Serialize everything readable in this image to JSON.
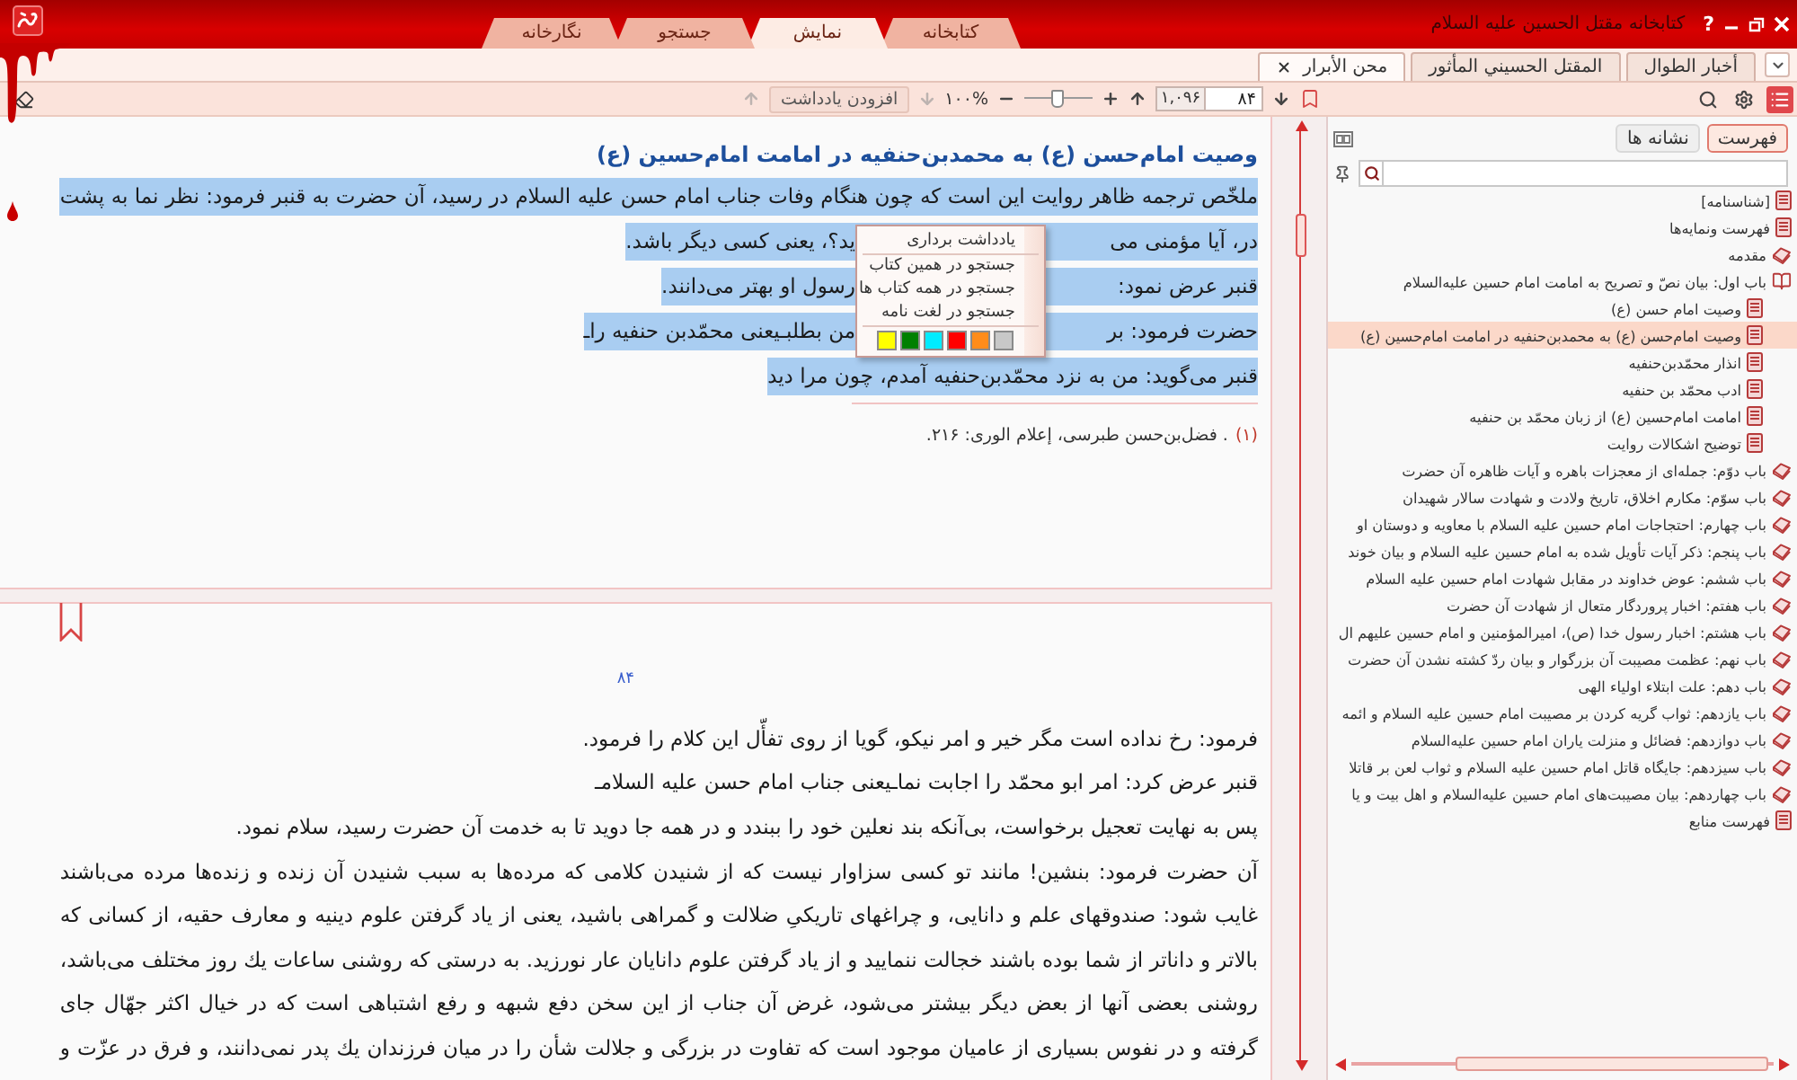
{
  "window": {
    "title": "کتابخانه مقتل الحسین علیه السلام",
    "help": "?"
  },
  "main_tabs": [
    {
      "label": "کتابخانه",
      "selected": false
    },
    {
      "label": "نمایش",
      "selected": true
    },
    {
      "label": "جستجو",
      "selected": false
    },
    {
      "label": "نگارخانه",
      "selected": false
    }
  ],
  "book_tabs": [
    {
      "label": "أخبار الطوال",
      "selected": false
    },
    {
      "label": "المقتل الحسيني المأثور",
      "selected": false
    },
    {
      "label": "محن الأبرار",
      "selected": true
    }
  ],
  "toolbar": {
    "view_buttons": [
      {
        "kind": "contents",
        "selected": true
      },
      {
        "kind": "settings",
        "selected": false
      },
      {
        "kind": "search",
        "selected": false
      }
    ],
    "page": "۸۴",
    "page_count": "۱,۰۹۶",
    "zoom": {
      "level": 0.47,
      "reading": "۱۰۰%"
    },
    "add_note": "افزودن یادداشت",
    "note_nav_disabled": true
  },
  "sidebar": {
    "tabs": [
      {
        "label": "فهرست",
        "selected": true
      },
      {
        "label": "نشانه ها",
        "selected": false
      }
    ],
    "tree": [
      {
        "label": "[شناسنامه]",
        "kind": "page",
        "selected": false
      },
      {
        "label": "فهرست ونمایه‌ها",
        "kind": "page",
        "selected": false
      },
      {
        "label": "مقدمه",
        "kind": "book",
        "expanded": false,
        "selected": false
      },
      {
        "label": "باب اول: بیان نصّ و تصریح به امامت امام حسین علیه‌السلام",
        "kind": "book",
        "expanded": true,
        "selected": false,
        "children": [
          {
            "label": "وصیت امام حسن (ع)",
            "kind": "page",
            "selected": false
          },
          {
            "label": "وصیت امام‌حسن (ع) به محمدبن‌حنفیه در امامت امام‌حسین (ع)",
            "kind": "page",
            "selected": true
          },
          {
            "label": "انذار محمّدبن‌حنفیه",
            "kind": "page",
            "selected": false
          },
          {
            "label": "ادب محمّد بن حنفیه",
            "kind": "page",
            "selected": false
          },
          {
            "label": "امامت امام‌حسین (ع) از زبان محمّد بن حنفیه",
            "kind": "page",
            "selected": false
          },
          {
            "label": "توضیح اشکالات روایت",
            "kind": "page",
            "selected": false
          }
        ]
      },
      {
        "label": "باب دوّم: جمله‌ای از معجزات باهره و آیات ظاهره آن حضرت",
        "kind": "book",
        "expanded": false,
        "selected": false
      },
      {
        "label": "باب سوّم: مکارم اخلاق، تاریخ ولادت و شهادت سالار شهیدان",
        "kind": "book",
        "expanded": false,
        "selected": false
      },
      {
        "label": "باب چهارم: احتجاجات امام حسین علیه السلام با معاویه و دوستان او",
        "kind": "book",
        "expanded": false,
        "selected": false
      },
      {
        "label": "باب پنجم: ذکر آیات تأویل شده به امام حسین علیه السلام و بیان خوند",
        "kind": "book",
        "expanded": false,
        "selected": false
      },
      {
        "label": "باب ششم: عوض خداوند در مقابل شهادت امام حسین علیه السلام",
        "kind": "book",
        "expanded": false,
        "selected": false
      },
      {
        "label": "باب هفتم: اخبار پروردگار متعال از شهادت آن حضرت",
        "kind": "book",
        "expanded": false,
        "selected": false
      },
      {
        "label": "باب هشتم: اخبار رسول خدا (ص)، امیرالمؤمنین و امام حسین علیهم ال",
        "kind": "book",
        "expanded": false,
        "selected": false
      },
      {
        "label": "باب نهم: عظمت مصیبت آن بزرگوار و بیان ردّ کشته نشدن آن حضرت",
        "kind": "book",
        "expanded": false,
        "selected": false
      },
      {
        "label": "باب دهم: علت ابتلاء اولیاء الهی",
        "kind": "book",
        "expanded": false,
        "selected": false
      },
      {
        "label": "باب یازدهم: ثواب گریه کردن بر مصیبت امام حسین علیه السلام و ائمه",
        "kind": "book",
        "expanded": false,
        "selected": false
      },
      {
        "label": "باب دوازدهم: فضائل و منزلت یاران امام حسین علیه‌السلام",
        "kind": "book",
        "expanded": false,
        "selected": false
      },
      {
        "label": "باب سیزدهم: جایگاه قاتل امام حسین علیه السلام و ثواب لعن بر قاتلا",
        "kind": "book",
        "expanded": false,
        "selected": false
      },
      {
        "label": "باب چهاردهم: بیان مصیبت‌های امام حسین علیه‌السلام و اهل بیت و یا",
        "kind": "book",
        "expanded": false,
        "selected": false
      },
      {
        "label": "فهرست منابع",
        "kind": "page",
        "selected": false
      }
    ]
  },
  "pages": [
    {
      "heading": "وصیت امام‌حسن (ع) به محمدبن‌حنفیه در امامت امام‌حسین (ع)",
      "paragraphs": [
        {
          "selected": true,
          "lines": [
            [
              "ملخّص ترجمه ظاهر روایت این است که چون هنگام وفات جناب امام حسن علیه السلام در رسید، آن حضرت به قنبر فرمود: نظر نما به پشت"
            ],
            [
              "در، آیا مؤمنی می",
              "ید؟، یعنی کسی دیگر باشد."
            ]
          ]
        },
        {
          "selected": true,
          "lines": [
            [
              "قنبر عرض نمود:",
              "رسول او بهتر می‌دانند."
            ]
          ]
        },
        {
          "selected": true,
          "lines": [
            [
              "حضرت فرمود: بر",
              "من بطلبـیعنی محمّدبن حنفیه راـ"
            ]
          ]
        },
        {
          "selected": true,
          "lines": [
            [
              "قنبر می‌گوید: من به نزد محمّدبن‌حنفیه آمدم، چون مرا دید"
            ]
          ]
        }
      ],
      "footnotes": [
        {
          "mark": "(۱)",
          "text": ". فضل‌بن‌حسن طبرسی، إعلام الوری: ۲۱۶."
        }
      ]
    },
    {
      "bookmark": true,
      "number": "۸۴",
      "paragraphs": [
        {
          "selected": false,
          "lines": [
            [
              "فرمود: رخ نداده است مگر خیر و امر نیکو، گویا از روی تفأّل این کلام را فرمود."
            ]
          ]
        },
        {
          "selected": false,
          "lines": [
            [
              "قنبر عرض کرد: امر ابو محمّد را اجابت نماـیعنی جناب امام حسن علیه السلامـ"
            ]
          ]
        },
        {
          "selected": false,
          "lines": [
            [
              "پس به نهایت تعجیل برخواست، بی‌آنکه بند نعلین خود را ببندد و در همه جا دوید تا به خدمت آن حضرت رسید، سلام نمود."
            ]
          ]
        },
        {
          "selected": false,
          "continues": true,
          "lines": [
            [
              "آن حضرت فرمود: بنشین! مانند تو کسی سزاوار نیست که از شنیدن کلامی که مرده‌ها به سبب شنیدن آن زنده و زنده‌ها مرده می‌باشند"
            ],
            [
              "غایب شود: صندوقهای علم و دانایی، و چراغهای تاریکیِ ضلالت و گمراهی باشید، یعنی از یاد گرفتن علوم دینیه و معارف حقیه، از کسانی که"
            ],
            [
              "بالاتر و داناتر از شما بوده باشند خجالت ننمایید و از یاد گرفتن علوم دانایان عار نورزید. به درستی که روشنی ساعات یك روز مختلف می‌باشد،"
            ],
            [
              "روشنی بعضی آنها از بعض دیگر بیشتر می‌شود، غرض آن جناب از این سخن دفع شبهه و رفع اشتباهی است که در خیال اکثر جهّال جای"
            ],
            [
              "گرفته و در نفوس بسیاری از عامیان موجود است که تفاوت در بزرگی و جلالت شأن را در میان فرزندان یك پدر نمی‌دانند، و فرق در عزّت و"
            ]
          ]
        }
      ]
    }
  ],
  "context_menu": {
    "items": [
      {
        "label": "یادداشت برداری"
      },
      {
        "label": "جستجو در همین کتاب"
      },
      {
        "label": "جستجو در همه کتاب ها"
      },
      {
        "label": "جستجو در لغت نامه"
      }
    ],
    "colors": [
      {
        "color": "#c8c8c8"
      },
      {
        "color": "#ff8c1a"
      },
      {
        "color": "#ff0000"
      },
      {
        "color": "#00ecff"
      },
      {
        "color": "#008000"
      },
      {
        "color": "#ffff00"
      }
    ]
  }
}
